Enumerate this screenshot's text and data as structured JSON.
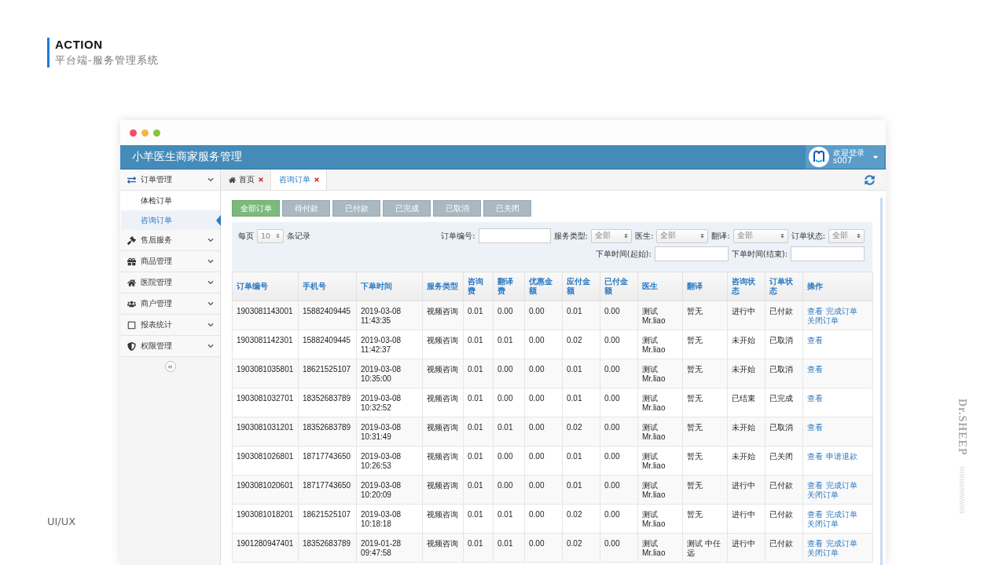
{
  "slide": {
    "heading": "ACTION",
    "subheading": "平台端-服务管理系统",
    "footer_label": "UI/UX",
    "signature": "Dr.SHEEP"
  },
  "app": {
    "title": "小羊医生商家服务管理",
    "user": {
      "greeting": "欢迎登录",
      "username": "s007"
    }
  },
  "sidebar": {
    "items": [
      {
        "label": "订单管理",
        "children": [
          {
            "label": "体检订单",
            "selected": false
          },
          {
            "label": "咨询订单",
            "selected": true
          }
        ]
      },
      {
        "label": "售后服务"
      },
      {
        "label": "商品管理"
      },
      {
        "label": "医院管理"
      },
      {
        "label": "商户管理"
      },
      {
        "label": "报表统计"
      },
      {
        "label": "权限管理"
      }
    ]
  },
  "tabs": [
    {
      "label": "首页",
      "selected": false
    },
    {
      "label": "咨询订单",
      "selected": true
    }
  ],
  "status_filters": [
    {
      "label": "全部订单",
      "selected": true
    },
    {
      "label": "待付款",
      "selected": false
    },
    {
      "label": "已付款",
      "selected": false
    },
    {
      "label": "已完成",
      "selected": false
    },
    {
      "label": "已取消",
      "selected": false
    },
    {
      "label": "已关闭",
      "selected": false
    }
  ],
  "filters": {
    "page_size_label": "每页",
    "page_size": "10",
    "records_label": "条记录",
    "fields": [
      {
        "kind": "input",
        "label": "订单编号:"
      },
      {
        "kind": "select",
        "label": "服务类型:",
        "value": "全部"
      },
      {
        "kind": "select",
        "label": "医生:",
        "value": "全部"
      },
      {
        "kind": "select",
        "label": "翻译:",
        "value": "全部"
      },
      {
        "kind": "select",
        "label": "订单状态:",
        "value": "全部"
      }
    ],
    "date_fields": [
      {
        "label": "下单时间(起始):"
      },
      {
        "label": "下单时间(结束):"
      }
    ]
  },
  "table": {
    "columns": [
      "订单编号",
      "手机号",
      "下单时间",
      "服务类型",
      "咨询费",
      "翻译费",
      "优惠金额",
      "应付金额",
      "已付金额",
      "医生",
      "翻译",
      "咨询状态",
      "订单状态",
      "操作"
    ],
    "rows": [
      {
        "cells": [
          "1903081143001",
          "15882409445",
          "2019-03-08 11:43:35",
          "视频咨询",
          "0.01",
          "0.00",
          "0.00",
          "0.01",
          "0.00",
          "测试 Mr.liao",
          "暂无",
          "进行中",
          "已付款"
        ],
        "actions": [
          "查看",
          "完成订单",
          "关闭订单"
        ]
      },
      {
        "cells": [
          "1903081142301",
          "15882409445",
          "2019-03-08 11:42:37",
          "视频咨询",
          "0.01",
          "0.01",
          "0.00",
          "0.02",
          "0.00",
          "测试 Mr.liao",
          "暂无",
          "未开始",
          "已取消"
        ],
        "actions": [
          "查看"
        ]
      },
      {
        "cells": [
          "1903081035801",
          "18621525107",
          "2019-03-08 10:35:00",
          "视频咨询",
          "0.01",
          "0.00",
          "0.00",
          "0.01",
          "0.00",
          "测试 Mr.liao",
          "暂无",
          "未开始",
          "已取消"
        ],
        "actions": [
          "查看"
        ]
      },
      {
        "cells": [
          "1903081032701",
          "18352683789",
          "2019-03-08 10:32:52",
          "视频咨询",
          "0.01",
          "0.00",
          "0.00",
          "0.01",
          "0.00",
          "测试 Mr.liao",
          "暂无",
          "已结束",
          "已完成"
        ],
        "actions": [
          "查看"
        ]
      },
      {
        "cells": [
          "1903081031201",
          "18352683789",
          "2019-03-08 10:31:49",
          "视频咨询",
          "0.01",
          "0.01",
          "0.00",
          "0.02",
          "0.00",
          "测试 Mr.liao",
          "暂无",
          "未开始",
          "已取消"
        ],
        "actions": [
          "查看"
        ]
      },
      {
        "cells": [
          "1903081026801",
          "18717743650",
          "2019-03-08 10:26:53",
          "视频咨询",
          "0.01",
          "0.00",
          "0.00",
          "0.01",
          "0.00",
          "测试 Mr.liao",
          "暂无",
          "未开始",
          "已关闭"
        ],
        "actions": [
          "查看",
          "申请退款"
        ]
      },
      {
        "cells": [
          "1903081020601",
          "18717743650",
          "2019-03-08 10:20:09",
          "视频咨询",
          "0.01",
          "0.00",
          "0.00",
          "0.01",
          "0.00",
          "测试 Mr.liao",
          "暂无",
          "进行中",
          "已付款"
        ],
        "actions": [
          "查看",
          "完成订单",
          "关闭订单"
        ]
      },
      {
        "cells": [
          "1903081018201",
          "18621525107",
          "2019-03-08 10:18:18",
          "视频咨询",
          "0.01",
          "0.01",
          "0.00",
          "0.02",
          "0.00",
          "测试 Mr.liao",
          "暂无",
          "进行中",
          "已付款"
        ],
        "actions": [
          "查看",
          "完成订单",
          "关闭订单"
        ]
      },
      {
        "cells": [
          "1901280947401",
          "18352683789",
          "2019-01-28 09:47:58",
          "视频咨询",
          "0.01",
          "0.01",
          "0.00",
          "0.02",
          "0.00",
          "测试 Mr.liao",
          "测试 中任远",
          "进行中",
          "已付款"
        ],
        "actions": [
          "查看",
          "完成订单",
          "关闭订单"
        ]
      }
    ]
  }
}
